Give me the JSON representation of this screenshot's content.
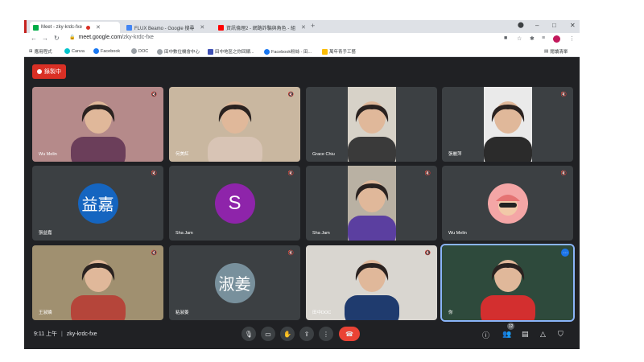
{
  "browser": {
    "tabs": [
      {
        "title": "Meet - zky-krdc-fxe",
        "active": true
      },
      {
        "title": "FLUX Beamo - Google 搜尋"
      },
      {
        "title": "資訊倫理2 - 網路詐騙與角色 - 組"
      }
    ],
    "new_tab": "+",
    "window_controls": [
      "–",
      "□",
      "✕"
    ],
    "url_host": "meet.google.com",
    "url_path": "/zky-krdc-fxe",
    "bookmarks": [
      "應用程式",
      "Canva",
      "Facebook",
      "DOC",
      "田中數位機會中心",
      "田中地區之你回饋...",
      "Facebook粉絲 - 田...",
      "萬年青手工藝"
    ],
    "reading_list": "閱讀清單"
  },
  "meet": {
    "recording_label": "錄製中",
    "participants": [
      {
        "name": "Wu Melin",
        "type": "video",
        "bg": "#b58a8a",
        "fg": "#6b3e5a"
      },
      {
        "name": "何美紅",
        "type": "video",
        "bg": "#c9b7a0",
        "fg": "#d8c4b5"
      },
      {
        "name": "Grace Chiu",
        "type": "video",
        "bg": "#d7d2c8",
        "fg": "#3a3a3a"
      },
      {
        "name": "張麗萍",
        "type": "video",
        "bg": "#eaeaea",
        "fg": "#2b2b2b"
      },
      {
        "name": "張益嘉",
        "type": "avatar",
        "avatar_text": "益嘉",
        "color": "#1565c0"
      },
      {
        "name": "Sha Jam",
        "type": "avatar",
        "avatar_text": "S",
        "color": "#8e24aa"
      },
      {
        "name": "Sha Jam",
        "type": "video",
        "bg": "#b9b1a3",
        "fg": "#5b3fa0"
      },
      {
        "name": "Wu Melin",
        "type": "avatar_photo",
        "color": "#f4a6a6"
      },
      {
        "name": "王淑嬌",
        "type": "video",
        "bg": "#a09070",
        "fg": "#b5453a"
      },
      {
        "name": "粘淑姜",
        "type": "avatar",
        "avatar_text": "淑姜",
        "color": "#78909c"
      },
      {
        "name": "田中DOC",
        "type": "video",
        "bg": "#d9d6d0",
        "fg": "#1f3b6e"
      },
      {
        "name": "你",
        "type": "video",
        "bg": "#2e4a3c",
        "fg": "#d32f2f"
      }
    ],
    "clock": "9:11 上午",
    "separator": "|",
    "meeting_code": "zky-krdc-fxe",
    "participant_count": "12",
    "accent": "#1a73e8",
    "end_call_color": "#ea4335"
  }
}
